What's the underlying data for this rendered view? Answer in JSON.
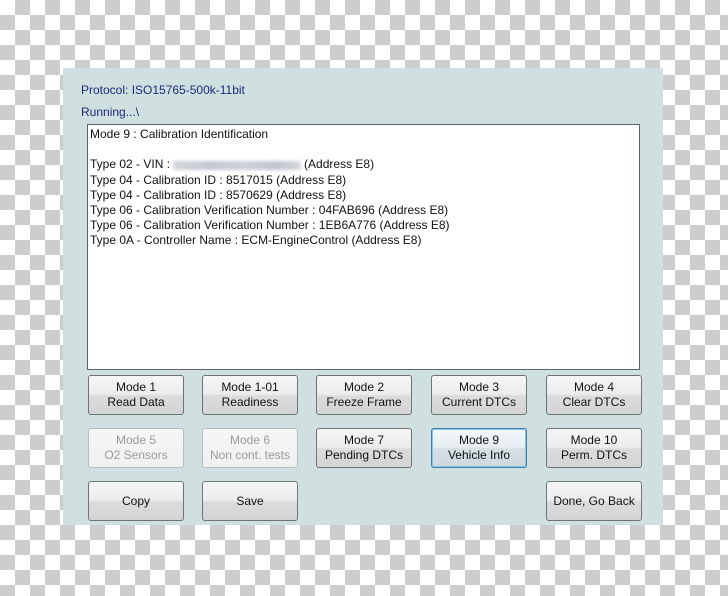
{
  "header": {
    "protocol": "Protocol: ISO15765-500k-11bit",
    "status": "Running...\\"
  },
  "output": {
    "title": "Mode 9 : Calibration Identification",
    "lines": [
      {
        "prefix": "Type 02 - VIN :",
        "value_redacted": true,
        "suffix": "(Address E8)"
      },
      {
        "text": "Type 04 - Calibration ID : 8517015 (Address E8)"
      },
      {
        "text": "Type 04 - Calibration ID : 8570629 (Address E8)"
      },
      {
        "text": "Type 06 - Calibration Verification Number : 04FAB696 (Address E8)"
      },
      {
        "text": "Type 06 - Calibration Verification Number : 1EB6A776 (Address E8)"
      },
      {
        "text": "Type 0A - Controller Name : ECM-EngineControl (Address E8)"
      }
    ]
  },
  "mode_buttons": [
    {
      "line1": "Mode 1",
      "line2": "Read Data",
      "state": "enabled"
    },
    {
      "line1": "Mode 1-01",
      "line2": "Readiness",
      "state": "enabled"
    },
    {
      "line1": "Mode 2",
      "line2": "Freeze Frame",
      "state": "enabled"
    },
    {
      "line1": "Mode 3",
      "line2": "Current DTCs",
      "state": "enabled"
    },
    {
      "line1": "Mode 4",
      "line2": "Clear DTCs",
      "state": "enabled"
    },
    {
      "line1": "Mode 5",
      "line2": "O2 Sensors",
      "state": "disabled"
    },
    {
      "line1": "Mode 6",
      "line2": "Non cont. tests",
      "state": "disabled"
    },
    {
      "line1": "Mode 7",
      "line2": "Pending DTCs",
      "state": "enabled"
    },
    {
      "line1": "Mode 9",
      "line2": "Vehicle Info",
      "state": "focused"
    },
    {
      "line1": "Mode 10",
      "line2": "Perm. DTCs",
      "state": "enabled"
    }
  ],
  "actions": {
    "copy": "Copy",
    "save": "Save",
    "done": "Done, Go Back"
  },
  "colors": {
    "panel_bg": "#d0e0e0",
    "status_text": "#1a2a78",
    "focus_border": "#3d7fb0"
  }
}
